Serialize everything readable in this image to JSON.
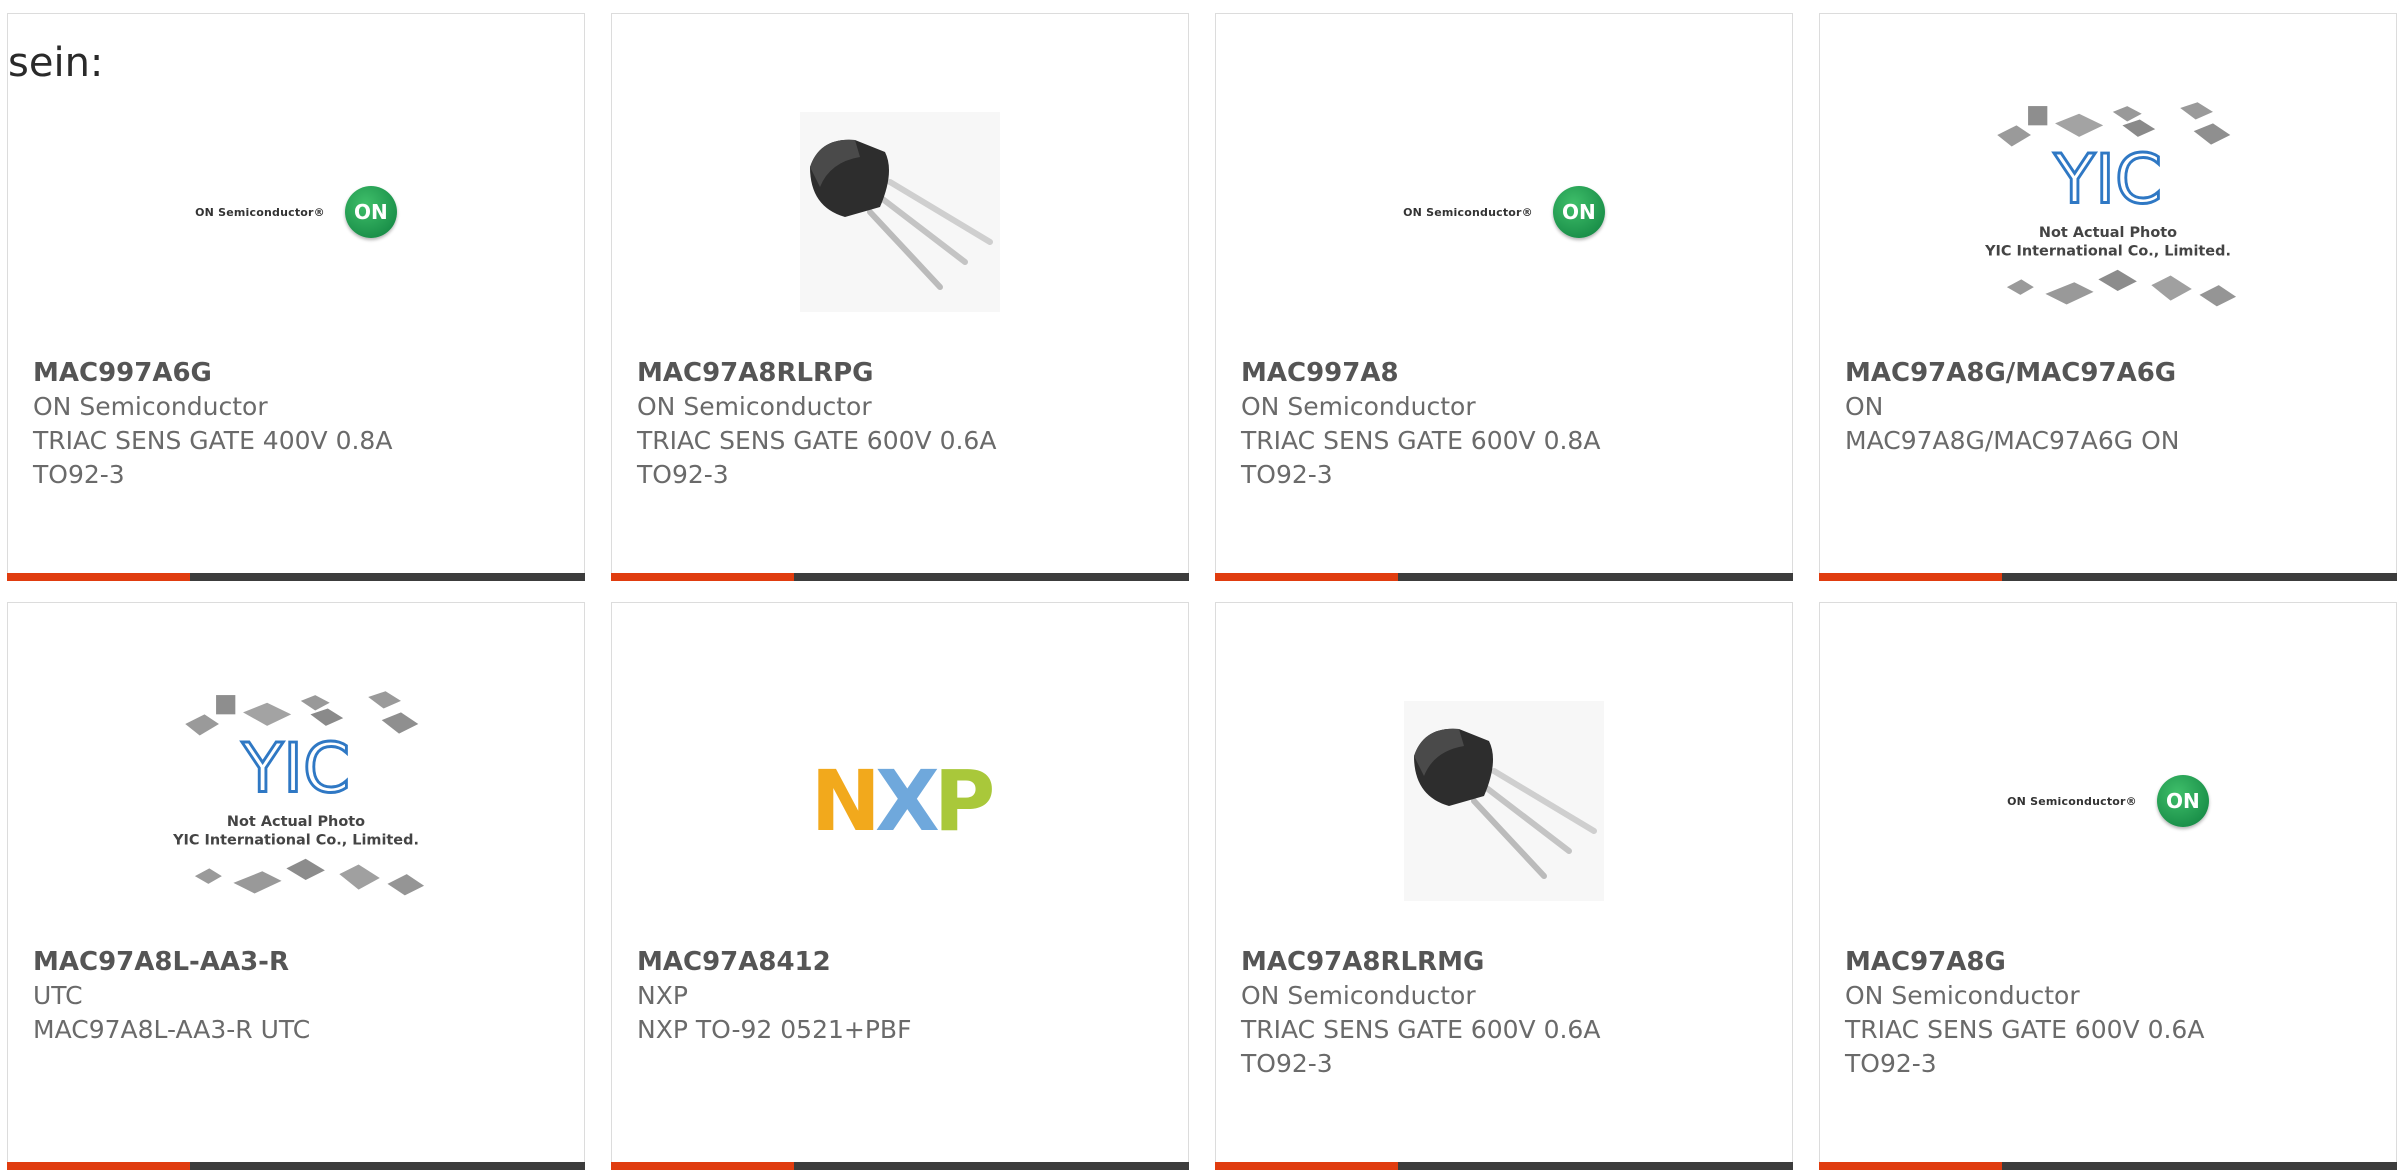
{
  "fragment_text": "sein:",
  "colors": {
    "accent": "#e03c0f",
    "bar": "#3c3c3c",
    "border": "#dcdcdc"
  },
  "cards": [
    {
      "part": "MAC997A6G",
      "lines": [
        "ON Semiconductor",
        "TRIAC SENS GATE 400V 0.8A",
        "TO92-3"
      ],
      "image": "on-semiconductor-logo",
      "logo_text": "ON Semiconductor®",
      "logo_mark": "ON"
    },
    {
      "part": "MAC97A8RLRPG",
      "lines": [
        "ON Semiconductor",
        "TRIAC SENS GATE 600V 0.6A",
        "TO92-3"
      ],
      "image": "to92-transistor-photo"
    },
    {
      "part": "MAC997A8",
      "lines": [
        "ON Semiconductor",
        "TRIAC SENS GATE 600V 0.8A",
        "TO92-3"
      ],
      "image": "on-semiconductor-logo",
      "logo_text": "ON Semiconductor®",
      "logo_mark": "ON"
    },
    {
      "part": "MAC97A8G/MAC97A6G",
      "lines": [
        "ON",
        "MAC97A8G/MAC97A6G ON"
      ],
      "image": "yic-placeholder",
      "placeholder_line1": "Not Actual Photo",
      "placeholder_line2": "YIC International Co., Limited."
    },
    {
      "part": "MAC97A8L-AA3-R",
      "lines": [
        "UTC",
        "MAC97A8L-AA3-R UTC"
      ],
      "image": "yic-placeholder",
      "placeholder_line1": "Not Actual Photo",
      "placeholder_line2": "YIC International Co., Limited."
    },
    {
      "part": "MAC97A8412",
      "lines": [
        "NXP",
        "NXP TO-92 0521+PBF"
      ],
      "image": "nxp-logo",
      "logo_letters": [
        "N",
        "X",
        "P"
      ]
    },
    {
      "part": "MAC97A8RLRMG",
      "lines": [
        "ON Semiconductor",
        "TRIAC SENS GATE 600V 0.6A",
        "TO92-3"
      ],
      "image": "to92-transistor-photo"
    },
    {
      "part": "MAC97A8G",
      "lines": [
        "ON Semiconductor",
        "TRIAC SENS GATE 600V 0.6A",
        "TO92-3"
      ],
      "image": "on-semiconductor-logo",
      "logo_text": "ON Semiconductor®",
      "logo_mark": "ON"
    }
  ]
}
